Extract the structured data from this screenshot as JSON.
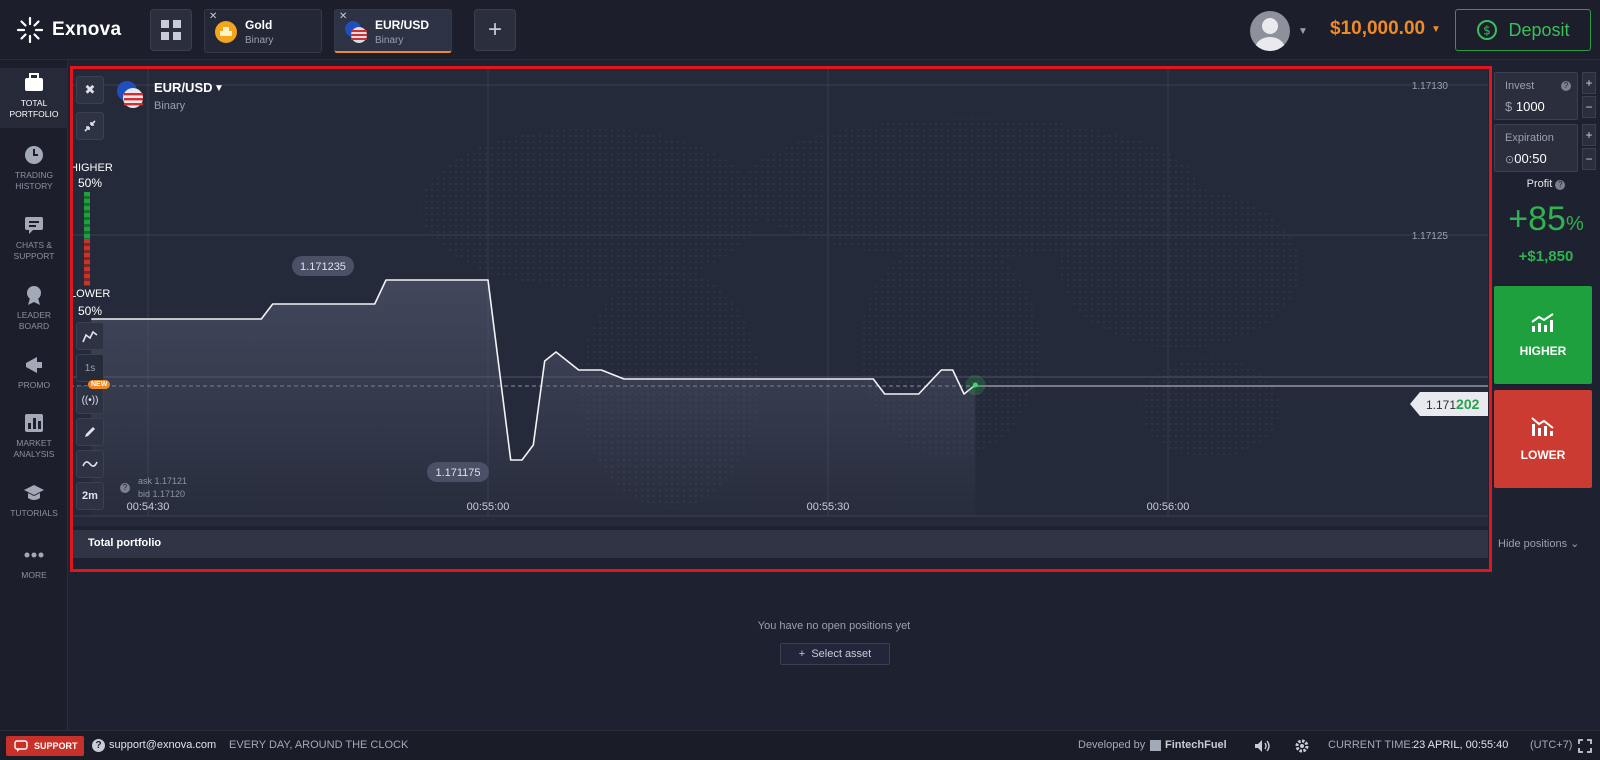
{
  "brand": {
    "name": "Exnova"
  },
  "tabs": [
    {
      "name": "Gold",
      "type": "Binary",
      "active": false
    },
    {
      "name": "EUR/USD",
      "type": "Binary",
      "active": true
    }
  ],
  "header": {
    "balance": "$10,000.00",
    "deposit_label": "Deposit"
  },
  "sidebar": {
    "items": [
      {
        "label1": "TOTAL",
        "label2": "PORTFOLIO",
        "icon": "briefcase-icon"
      },
      {
        "label1": "TRADING",
        "label2": "HISTORY",
        "icon": "clock-icon"
      },
      {
        "label1": "CHATS &",
        "label2": "SUPPORT",
        "icon": "chat-icon"
      },
      {
        "label1": "LEADER",
        "label2": "BOARD",
        "icon": "trophy-icon"
      },
      {
        "label1": "PROMO",
        "label2": "",
        "icon": "megaphone-icon"
      },
      {
        "label1": "MARKET",
        "label2": "ANALYSIS",
        "icon": "bar-chart-icon"
      },
      {
        "label1": "TUTORIALS",
        "label2": "",
        "icon": "graduation-icon"
      },
      {
        "label1": "MORE",
        "label2": "",
        "icon": "dots-icon"
      }
    ]
  },
  "chart": {
    "pair": "EUR/USD",
    "type": "Binary",
    "higher_label": "HIGHER",
    "higher_pct": "50%",
    "lower_label": "LOWER",
    "lower_pct": "50%",
    "timeframe": "1s",
    "candle_size": "2m",
    "new_badge": "NEW",
    "ask": "ask 1.17121",
    "bid": "bid 1.17120",
    "price_high_label": "1.171235",
    "price_low_label": "1.171175",
    "current_price_prefix": "1.171",
    "current_price_suffix": "202"
  },
  "chart_data": {
    "type": "line",
    "x_ticks": [
      "00:54:30",
      "00:55:00",
      "00:55:30",
      "00:56:00"
    ],
    "y_ticks": [
      "1.17130",
      "1.17125"
    ],
    "ylim": [
      1.17114,
      1.17131
    ],
    "series": [
      {
        "values": [
          {
            "t": "00:54:25",
            "y": 1.171222
          },
          {
            "t": "00:54:40",
            "y": 1.171222
          },
          {
            "t": "00:54:41",
            "y": 1.171227
          },
          {
            "t": "00:54:50",
            "y": 1.171227
          },
          {
            "t": "00:54:51",
            "y": 1.171235
          },
          {
            "t": "00:55:00",
            "y": 1.171235
          },
          {
            "t": "00:55:02",
            "y": 1.171175
          },
          {
            "t": "00:55:03",
            "y": 1.171175
          },
          {
            "t": "00:55:04",
            "y": 1.17118
          },
          {
            "t": "00:55:05",
            "y": 1.171208
          },
          {
            "t": "00:55:06",
            "y": 1.171211
          },
          {
            "t": "00:55:08",
            "y": 1.171205
          },
          {
            "t": "00:55:10",
            "y": 1.171205
          },
          {
            "t": "00:55:12",
            "y": 1.171202
          },
          {
            "t": "00:55:34",
            "y": 1.171202
          },
          {
            "t": "00:55:35",
            "y": 1.171197
          },
          {
            "t": "00:55:38",
            "y": 1.171197
          },
          {
            "t": "00:55:40",
            "y": 1.171205
          },
          {
            "t": "00:55:41",
            "y": 1.171205
          },
          {
            "t": "00:55:42",
            "y": 1.171197
          },
          {
            "t": "00:55:43",
            "y": 1.1712
          }
        ]
      }
    ],
    "grid": true
  },
  "trade": {
    "invest_label": "Invest",
    "invest_currency": "$",
    "invest_value": "1000",
    "expiration_label": "Expiration",
    "expiration_value": "00:50",
    "profit_label": "Profit",
    "profit_pct": "+85",
    "profit_pct_sign": "%",
    "profit_amount": "+$1,850",
    "higher_label": "HIGHER",
    "lower_label": "LOWER",
    "hide_positions": "Hide positions"
  },
  "portfolio": {
    "title": "Total portfolio",
    "empty_text": "You have no open positions yet",
    "select_asset": "Select asset"
  },
  "footer": {
    "support_label": "SUPPORT",
    "email": "support@exnova.com",
    "hours": "EVERY DAY, AROUND THE CLOCK",
    "developed_by": "Developed by",
    "developer": "FintechFuel",
    "current_time_label": "CURRENT TIME:",
    "current_time_value": "23 APRIL, 00:55:40",
    "timezone": "(UTC+7)"
  },
  "colors": {
    "accent_orange": "#f08a24",
    "green": "#1ea03f",
    "red": "#cc3b32",
    "frame": "#e0161f"
  }
}
